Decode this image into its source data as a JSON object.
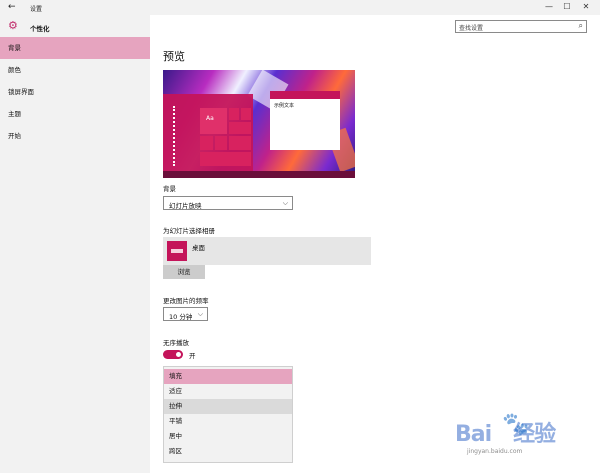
{
  "window": {
    "back_icon": "←",
    "title": "设置",
    "min_icon": "—",
    "max_icon": "☐",
    "close_icon": "✕"
  },
  "sidebar": {
    "gear_icon": "⚙",
    "title": "个性化",
    "items": [
      {
        "label": "背景",
        "active": true
      },
      {
        "label": "颜色"
      },
      {
        "label": "锁屏界面"
      },
      {
        "label": "主题"
      },
      {
        "label": "开始"
      }
    ]
  },
  "search": {
    "placeholder": "查找设置",
    "icon": "⌕"
  },
  "main": {
    "heading": "预览",
    "preview": {
      "tile_text": "Aa",
      "window_text": "示例文本"
    },
    "background": {
      "label": "背景",
      "value": "幻灯片放映",
      "arrow": "⌵"
    },
    "album": {
      "label": "为幻灯片选择相册",
      "name": "桌面",
      "browse": "浏览"
    },
    "frequency": {
      "label": "更改图片的频率",
      "value": "10 分钟",
      "arrow": "⌵"
    },
    "shuffle": {
      "label": "无序播放",
      "state": "开",
      "on": true
    },
    "fit": {
      "options": [
        "填充",
        "适应",
        "拉伸",
        "平铺",
        "居中",
        "跨区"
      ],
      "selected": "填充",
      "hover": "拉伸"
    }
  },
  "watermark": {
    "logo": "Bai",
    "paw": "🐾",
    "suffix": "经验",
    "url": "jingyan.baidu.com"
  },
  "colors": {
    "accent": "#c4145a",
    "selection": "#e6a4bf",
    "sidebar_bg": "#f2f2f2"
  }
}
